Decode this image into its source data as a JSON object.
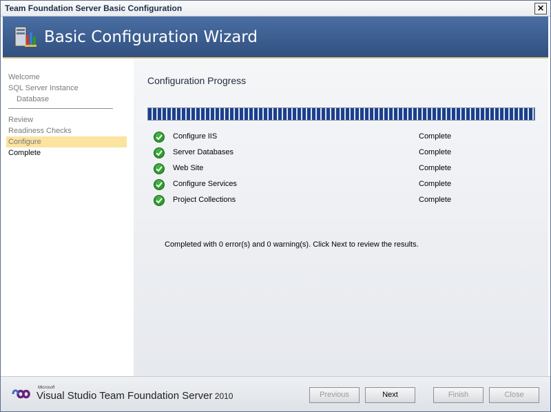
{
  "window": {
    "title": "Team Foundation Server Basic Configuration",
    "close_label": "✕"
  },
  "banner": {
    "heading": "Basic Configuration Wizard",
    "logo_icon": "server-config-icon"
  },
  "sidebar": {
    "items": [
      {
        "label": "Welcome",
        "state": "visited"
      },
      {
        "label": "SQL Server Instance",
        "state": "visited"
      },
      {
        "label": "Database",
        "state": "visited"
      },
      {
        "label": "Review",
        "state": "visited"
      },
      {
        "label": "Readiness Checks",
        "state": "visited"
      },
      {
        "label": "Configure",
        "state": "current"
      },
      {
        "label": "Complete",
        "state": "next"
      }
    ]
  },
  "main": {
    "title": "Configuration Progress",
    "progress_fraction": 1.0,
    "steps": [
      {
        "name": "Configure IIS",
        "status": "Complete"
      },
      {
        "name": "Server Databases",
        "status": "Complete"
      },
      {
        "name": "Web Site",
        "status": "Complete"
      },
      {
        "name": "Configure Services",
        "status": "Complete"
      },
      {
        "name": "Project Collections",
        "status": "Complete"
      }
    ],
    "summary": "Completed with 0 error(s) and 0 warning(s). Click Next to review the results."
  },
  "footer": {
    "logo_microsoft": "Microsoft",
    "logo_product": "Visual Studio",
    "logo_tfs": " Team Foundation Server",
    "logo_year": " 2010",
    "buttons": {
      "previous": "Previous",
      "next": "Next",
      "finish": "Finish",
      "close": "Close"
    }
  },
  "colors": {
    "banner": "#3f6094",
    "current_step": "#fbe3a0",
    "progress": "#1b3f8b",
    "check": "#2e9a2a"
  }
}
